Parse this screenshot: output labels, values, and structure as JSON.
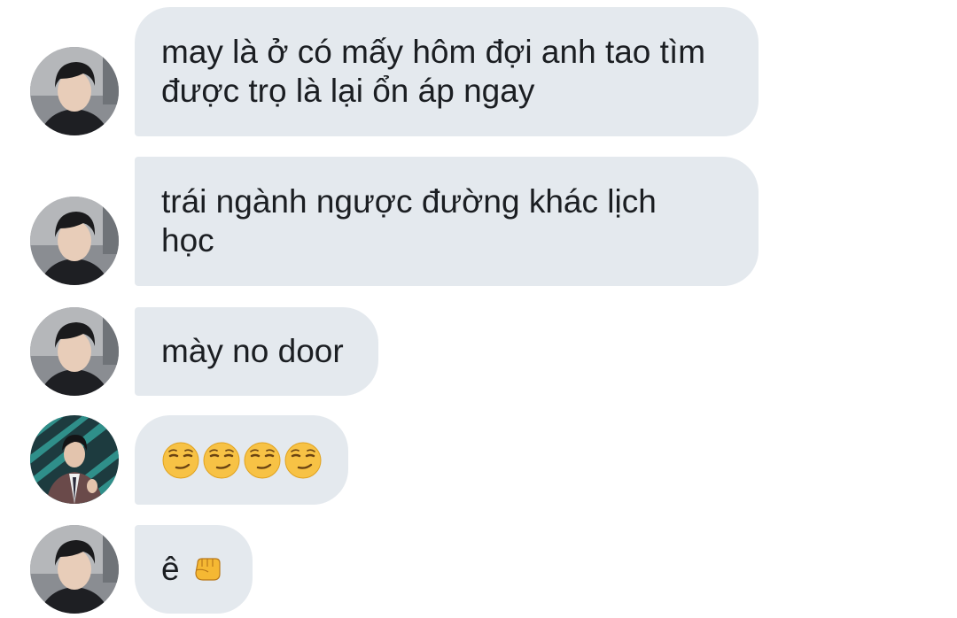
{
  "messages": [
    {
      "type": "text",
      "avatar": "contact-photo-a",
      "text": "may là ở có mấy hôm đợi anh tao tìm\nđược trọ là lại ổn áp ngay"
    },
    {
      "type": "text",
      "avatar": "contact-photo-a",
      "text": "trái ngành ngược đường khác lịch\nhọc"
    },
    {
      "type": "text",
      "avatar": "contact-photo-a",
      "text": "mày no door"
    },
    {
      "type": "emoji",
      "avatar": "contact-photo-b",
      "emoji": "😏😏😏😏"
    },
    {
      "type": "text-emoji",
      "avatar": "contact-photo-a",
      "text": "ê",
      "emoji": "👊"
    }
  ],
  "colors": {
    "bubble_bg": "#e4e9ee",
    "text": "#1b1e22",
    "background": "#ffffff"
  },
  "icons": [
    "smirk-emoji-icon",
    "fist-emoji-icon"
  ]
}
